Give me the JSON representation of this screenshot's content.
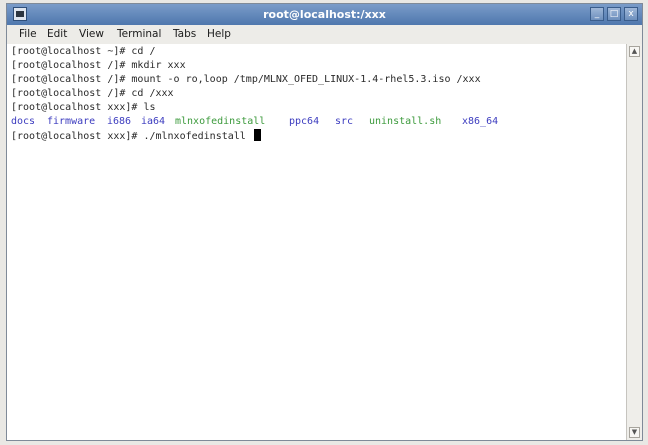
{
  "window": {
    "title": "root@localhost:/xxx",
    "buttons": {
      "minimize": "_",
      "maximize": "□",
      "close": "x"
    }
  },
  "menubar": {
    "items": [
      {
        "label": "File"
      },
      {
        "label": "Edit"
      },
      {
        "label": "View"
      },
      {
        "label": "Terminal"
      },
      {
        "label": "Tabs"
      },
      {
        "label": "Help"
      }
    ]
  },
  "terminal": {
    "lines": [
      "[root@localhost ~]# cd /",
      "[root@localhost /]# mkdir xxx",
      "[root@localhost /]# mount -o ro,loop /tmp/MLNX_OFED_LINUX-1.4-rhel5.3.iso /xxx",
      "[root@localhost /]# cd /xxx",
      "[root@localhost xxx]# ls"
    ],
    "ls_output": [
      {
        "name": "docs",
        "color": "#3b3bbf"
      },
      {
        "name": "firmware",
        "color": "#3b3bbf"
      },
      {
        "name": "i686",
        "color": "#3b3bbf"
      },
      {
        "name": "ia64",
        "color": "#3b3bbf"
      },
      {
        "name": "mlnxofedinstall",
        "color": "#3c9a3c"
      },
      {
        "name": "ppc64",
        "color": "#3b3bbf"
      },
      {
        "name": "src",
        "color": "#3b3bbf"
      },
      {
        "name": "uninstall.sh",
        "color": "#3c9a3c"
      },
      {
        "name": "x86_64",
        "color": "#3b3bbf"
      }
    ],
    "prompt_line": "[root@localhost xxx]# ./mlnxofedinstall "
  },
  "scrollbar": {
    "up_arrow": "▲",
    "down_arrow": "▼"
  }
}
